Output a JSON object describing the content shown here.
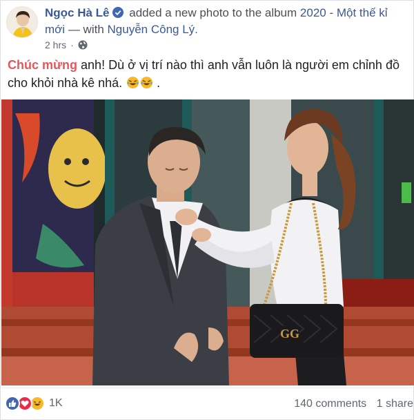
{
  "header": {
    "author": "Ngọc Hà Lê",
    "action_text": "added a new photo to the album",
    "album_name": "2020 - Một thế kỉ mới",
    "with_text": "— with",
    "tagged": "Nguyễn Công Lý.",
    "timestamp": "2 hrs",
    "separator": "·"
  },
  "post": {
    "hashtag": "Chúc mừng",
    "body": " anh! Dù ở vị trí nào thì anh vẫn luôn là người em chỉnh đồ cho khỏi nhà kê nhá.",
    "trailing": "."
  },
  "photo": {
    "bag_logo": "GG"
  },
  "footer": {
    "reaction_count": "1K",
    "comments": "140 comments",
    "shares": "1 share"
  },
  "colors": {
    "link": "#385898",
    "hashtag": "#e2585c",
    "like_blue": "#4267b2",
    "love_red": "#f0284a",
    "haha_yellow": "#f7b928"
  },
  "icons": [
    "verified-badge-icon",
    "globe-icon",
    "laughing-emoji-icon",
    "like-reaction-icon",
    "love-reaction-icon",
    "haha-reaction-icon"
  ]
}
